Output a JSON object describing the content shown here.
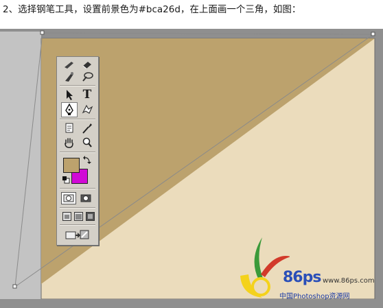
{
  "instruction": {
    "text": "2、选择钢笔工具，设置前景色为#bca26d，在上面画一个三角，如图："
  },
  "canvas": {
    "triangle_fill": "#bca26d",
    "canvas_fill": "#ebdcbc",
    "workspace_bg": "#8f8f8f",
    "path_stroke": "#8a8a8a"
  },
  "tools_palette": {
    "foreground_color": "#bca26d",
    "background_color": "#d10ad6",
    "active_tool": "pen-tool",
    "tools": [
      "brush-tool",
      "eraser-tool",
      "smudge-tool",
      "dodge-tool",
      "path-selection-tool",
      "type-tool",
      "pen-tool",
      "custom-shape-tool",
      "notes-tool",
      "eyedropper-tool",
      "hand-tool",
      "zoom-tool"
    ],
    "type_tool_glyph": "T"
  },
  "watermark": {
    "brand": "86ps",
    "site": "www.86ps.com",
    "caption": "中国Photoshop资源网"
  }
}
